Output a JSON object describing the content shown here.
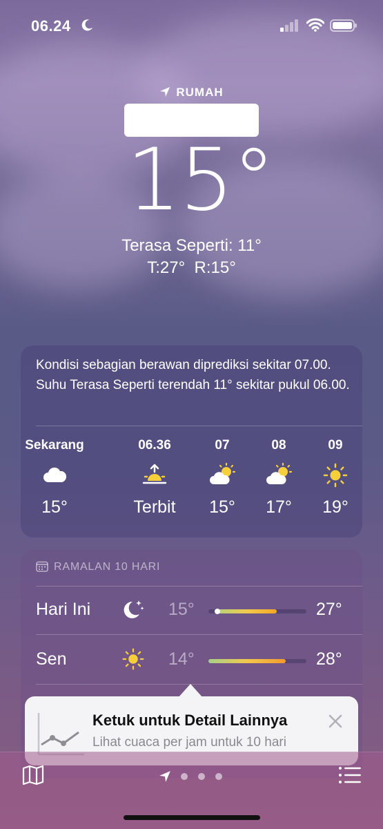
{
  "status": {
    "time": "06.24"
  },
  "location": {
    "label": "RUMAH"
  },
  "current": {
    "temp": "15°",
    "feels_like": "Terasa Seperti: 11°",
    "hi_lo": "T:27°  R:15°"
  },
  "hourly_card": {
    "summary": "Kondisi sebagian berawan diprediksi sekitar 07.00. Suhu Terasa Seperti terendah 11° sekitar pukul 06.00.",
    "hours": [
      {
        "label": "Sekarang",
        "icon": "cloud-icon",
        "value": "15°"
      },
      {
        "label": "06.36",
        "icon": "sunrise-icon",
        "value": "Terbit"
      },
      {
        "label": "07",
        "icon": "partly-cloudy-icon",
        "value": "15°"
      },
      {
        "label": "08",
        "icon": "partly-cloudy-icon",
        "value": "17°"
      },
      {
        "label": "09",
        "icon": "sun-icon",
        "value": "19°"
      }
    ]
  },
  "daily_card": {
    "header": "RAMALAN 10 HARI",
    "days": [
      {
        "name": "Hari Ini",
        "icon": "moon-stars-icon",
        "low": "15°",
        "high": "27°",
        "bar_start": 0.1,
        "bar_end": 0.7,
        "colors": [
          "#b8d27a",
          "#f2c94c",
          "#f5a623"
        ]
      },
      {
        "name": "Sen",
        "icon": "sun-icon",
        "low": "14°",
        "high": "28°",
        "bar_start": 0.0,
        "bar_end": 0.79,
        "colors": [
          "#a6d08a",
          "#f2c94c",
          "#f29a2e"
        ]
      }
    ]
  },
  "tooltip": {
    "title": "Ketuk untuk Detail Lainnya",
    "subtitle": "Lihat cuaca per jam untuk 10 hari"
  },
  "colors": {
    "accent_sun": "#f7cf3b",
    "tooltip_bg": "#f4f4f6"
  }
}
